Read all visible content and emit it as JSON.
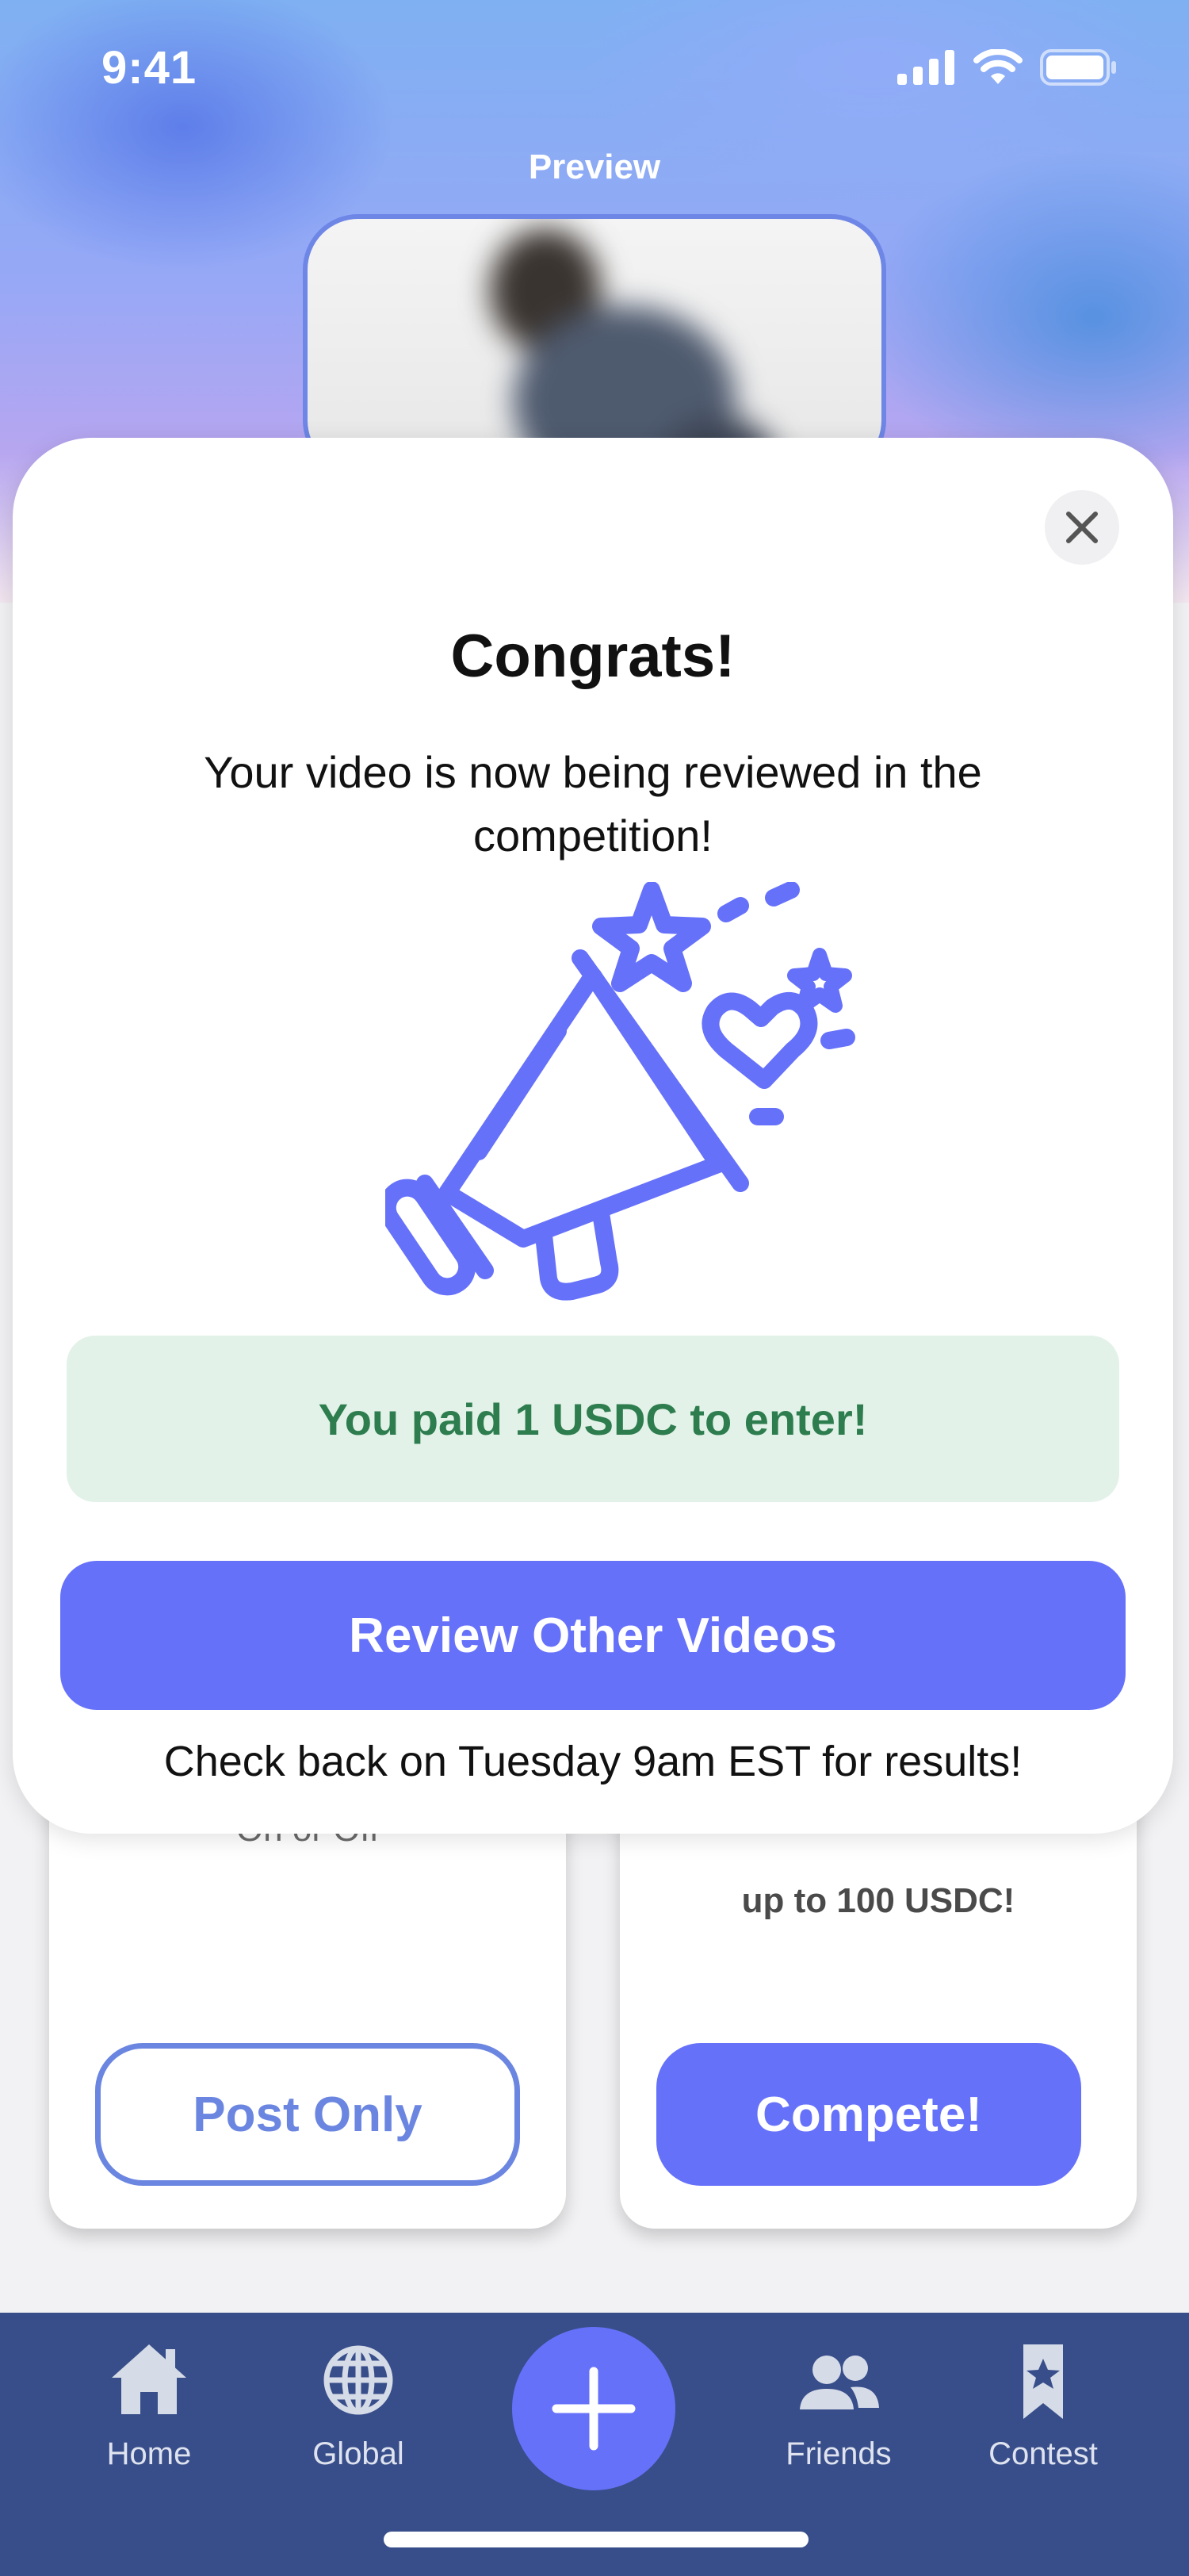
{
  "status_bar": {
    "time": "9:41"
  },
  "preview": {
    "label": "Preview"
  },
  "cards": {
    "left": {
      "text": "On or Off",
      "button_label": "Post Only"
    },
    "right": {
      "text": "up to 100 USDC!",
      "button_label": "Compete!"
    }
  },
  "modal": {
    "title": "Congrats!",
    "subtitle": "Your video is now being reviewed in the competition!",
    "paid_notice": "You paid 1 USDC to enter!",
    "primary_button": "Review Other Videos",
    "footer_note": "Check back on Tuesday 9am EST for results!",
    "close_icon": "close-icon",
    "illustration_icon": "megaphone-celebration-icon"
  },
  "bottom_nav": {
    "items": [
      {
        "label": "Home",
        "icon": "home-icon"
      },
      {
        "label": "Global",
        "icon": "globe-icon"
      },
      {
        "label": "Friends",
        "icon": "friends-icon"
      },
      {
        "label": "Contest",
        "icon": "contest-ribbon-icon"
      }
    ],
    "center_button_icon": "plus-icon"
  },
  "colors": {
    "accent": "#6671fa",
    "nav_background": "#384e8a",
    "success_text": "#2e7d4f",
    "success_bg": "#e3f2e8",
    "outline_button": "#6b86e0"
  }
}
